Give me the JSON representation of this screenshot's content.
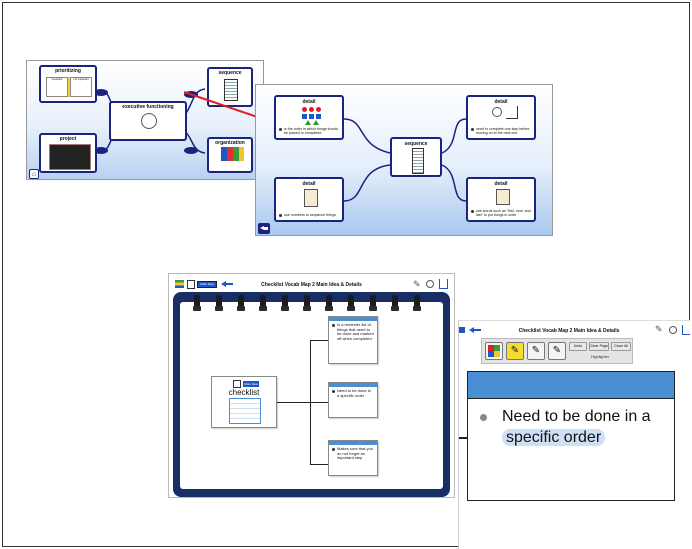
{
  "map1": {
    "center": "executive functioning",
    "nodes": {
      "prioritizing": "prioritizing",
      "sequence": "sequence",
      "project": "project",
      "organization": "organization"
    },
    "prioritizing_cols": [
      "important",
      "not important"
    ]
  },
  "map2": {
    "center": "sequence",
    "detail_label": "detail",
    "details": [
      "is the order in which things should be placed or completed",
      "need to complete one step before moving on to the next one",
      "use numbers to sequence things",
      "use words such as \"first, next, and last\" to put things in order"
    ]
  },
  "app": {
    "title": "Checklist Vocab Map 2 Main Idea & Details",
    "center_word": "checklist",
    "toolbar_badge": "Main Idea",
    "cards": [
      "Is a reminder list of things that need to be done and marked off when completed",
      "Need to be done in a specific order",
      "Makes sure that you do not forget an important step"
    ]
  },
  "zoom": {
    "title": "Checklist Vocab Map 2 Main Idea & Details",
    "buttons": {
      "undo": "Undo",
      "clear_page": "Clear Page",
      "close_all": "Close All",
      "highlighter": "Highlighter"
    },
    "big_text_before": "Need to be done in a ",
    "big_text_highlight": "specific order"
  },
  "colors": {
    "navy": "#1a237e",
    "notebook": "#1a2e66",
    "accent": "#4a8fd3",
    "arrow": "#e02020",
    "highlight": "#cfe0f6"
  }
}
